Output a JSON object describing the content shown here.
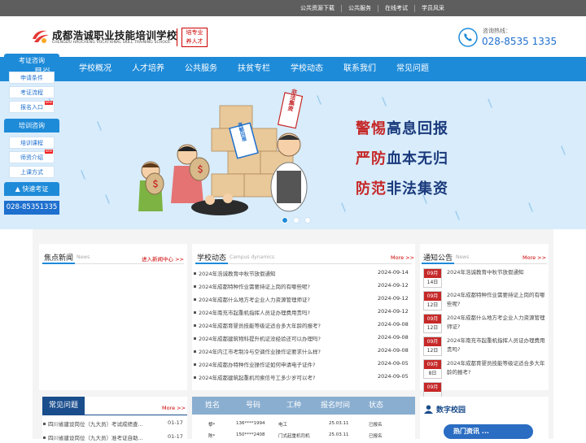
{
  "topbar": {
    "links": [
      "公共资源下载",
      "公共服务",
      "在线考试",
      "学员风采"
    ]
  },
  "header": {
    "school_name_cn": "成都浩诚职业技能培训学校",
    "school_name_en": "CHENGDU HAOCHENG VOCATIONAL SKILL TRAINING SCHOOL",
    "seal_lines": [
      "培专业",
      "养人才"
    ],
    "hotline_label": "咨询热线：",
    "hotline_number": "028-8535 1335"
  },
  "nav": {
    "items": [
      "首页",
      "学校概况",
      "人才培养",
      "公共服务",
      "扶贫专栏",
      "学校动态",
      "联系我们",
      "常见问题"
    ]
  },
  "banner": {
    "sign_text": "非法集资",
    "box_text": "高额回报",
    "bag_text": "＄",
    "slogans": [
      {
        "red": "警惕",
        "blue": "高息回报"
      },
      {
        "red": "严防",
        "blue": "血本无归"
      },
      {
        "red": "防范",
        "blue": "非法集资"
      }
    ],
    "slide_count": 3,
    "active_slide": 1
  },
  "sidebar": {
    "sections": [
      {
        "title": "考证咨询",
        "items": [
          "申请条件",
          "考证流程",
          "报名入口"
        ]
      },
      {
        "title": "培训咨询",
        "items": [
          "培训课程",
          "师资介绍",
          "上课方式"
        ]
      }
    ],
    "new_badge": "NEW",
    "quick_title": "快速考证",
    "phone": "028-85351335"
  },
  "focus_news": {
    "title": "焦点新闻",
    "sub": "News",
    "more": "进入新闻中心 >>"
  },
  "school_news": {
    "title": "学校动态",
    "sub": "Campus dynamics",
    "more": "More >>",
    "rows": [
      {
        "title": "2024年浩诚教育中秋节放假通知",
        "date": "2024-09-14"
      },
      {
        "title": "2024年成都特种作业需要持证上岗的有哪些呢?",
        "date": "2024-09-12"
      },
      {
        "title": "2024年成都什么地方考企业人力资源管理师证?",
        "date": "2024-09-12"
      },
      {
        "title": "2024年南充市起重机指挥人员证办理费用贵吗?",
        "date": "2024-09-12"
      },
      {
        "title": "2024年成都育婴员技能等级证适合多大年龄的报考?",
        "date": "2024-09-08"
      },
      {
        "title": "2024年成都建筑物科提升机证没经验还可以办理吗?",
        "date": "2024-09-08"
      },
      {
        "title": "2024年内江市考制冷与空调作业操作证要求什么样?",
        "date": "2024-09-08"
      },
      {
        "title": "2024年成都办特种作业操作证如何申请电子证件?",
        "date": "2024-09-05"
      },
      {
        "title": "2024年成都建筑起重机司索信号工多少岁可以考?",
        "date": "2024-09-05"
      }
    ]
  },
  "notices": {
    "title": "通知公告",
    "sub": "News",
    "more": "More >>",
    "rows": [
      {
        "month": "09月",
        "day": "14日",
        "title": "2024年浩诚教育中秋节放假通知"
      },
      {
        "month": "09月",
        "day": "12日",
        "title": "2024年成都特种作业需要持证上岗的有哪些呢?"
      },
      {
        "month": "09月",
        "day": "12日",
        "title": "2024年成都什么地方考企业人力资源管理师证?"
      },
      {
        "month": "09月",
        "day": "12日",
        "title": "2024年南充市起重机指挥人员证办理费用贵吗?"
      },
      {
        "month": "09月",
        "day": "8日",
        "title": "2024年成都育婴员技能等级证适合多大年龄的报考?"
      },
      {
        "month": "09月",
        "day": "",
        "title": ""
      }
    ]
  },
  "faq": {
    "title": "常见问题",
    "more": "More >>",
    "rows": [
      {
        "title": "四川省建设岗位（九大员）考试成绩查...",
        "date": "01-17"
      },
      {
        "title": "四川省建设岗位（九大员）准考证自助...",
        "date": "01-17"
      }
    ]
  },
  "score_table": {
    "headers": [
      "姓名",
      "号码",
      "工种",
      "报名时间",
      "状态"
    ],
    "rows": [
      [
        "黎*",
        "136****1994",
        "电工",
        "25.03.11",
        "已报名"
      ],
      [
        "陈*",
        "150****2408",
        "门式起重机司机",
        "25.03.11",
        "已报名"
      ]
    ]
  },
  "digital": {
    "title": "数字校园",
    "button": "热门资讯 ..."
  }
}
